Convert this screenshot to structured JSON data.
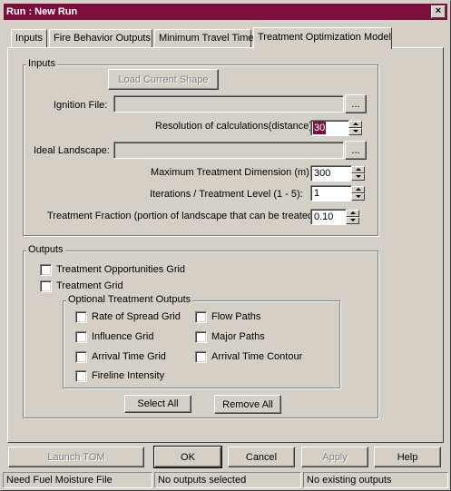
{
  "window": {
    "title": "Run : New Run",
    "close_glyph": "×"
  },
  "tabs": [
    {
      "label": "Inputs"
    },
    {
      "label": "Fire Behavior Outputs"
    },
    {
      "label": "Minimum Travel Time"
    },
    {
      "label": "Treatment Optimization Model"
    }
  ],
  "inputs": {
    "group_label": "Inputs",
    "load_shape_label": "Load Current Shape",
    "ignition_file_label": "Ignition File:",
    "ignition_file_value": "",
    "browse_label": "...",
    "resolution_label": "Resolution of calculations(distance):",
    "resolution_value": "30",
    "ideal_landscape_label": "Ideal Landscape:",
    "ideal_landscape_value": "",
    "max_dimension_label": "Maximum Treatment Dimension (m):",
    "max_dimension_value": "300",
    "iterations_label": "Iterations / Treatment Level (1 - 5):",
    "iterations_value": "1",
    "fraction_label": "Treatment Fraction (portion of landscape that can be treated):",
    "fraction_value": "0.10"
  },
  "outputs": {
    "group_label": "Outputs",
    "treatment_opportunities_label": "Treatment Opportunities Grid",
    "treatment_grid_label": "Treatment Grid",
    "optional": {
      "group_label": "Optional Treatment Outputs",
      "rate_of_spread_label": "Rate of Spread Grid",
      "influence_label": "Influence Grid",
      "arrival_time_label": "Arrival Time Grid",
      "fireline_label": "Fireline Intensity",
      "flow_paths_label": "Flow Paths",
      "major_paths_label": "Major Paths",
      "arrival_contour_label": "Arrival Time Contour"
    },
    "select_all_label": "Select All",
    "remove_all_label": "Remove All"
  },
  "footer": {
    "launch_label": "Launch TOM",
    "ok_label": "OK",
    "cancel_label": "Cancel",
    "apply_label": "Apply",
    "help_label": "Help"
  },
  "status": {
    "left": "Need Fuel Moisture File",
    "middle": "No outputs selected",
    "right": "No existing outputs"
  },
  "colors": {
    "titlebar": "#7b0f3c",
    "face": "#d4d0c8",
    "selection": "#7b0f3c"
  }
}
